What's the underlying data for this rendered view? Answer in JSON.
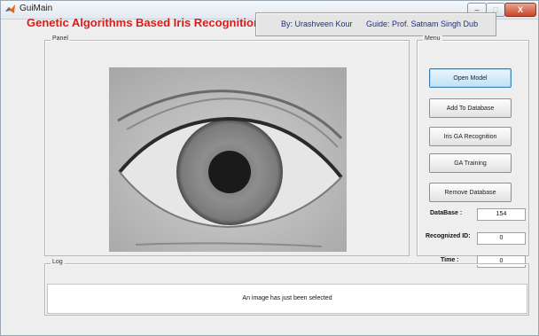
{
  "window": {
    "title": "GuiMain",
    "buttons": {
      "minimize": "–",
      "maximize": "□",
      "close": "X"
    }
  },
  "header": {
    "title": "Genetic Algorithms Based Iris Recognition",
    "author": "By: Urashveen Kour",
    "guide": "Guide: Prof. Satnam Singh Dub"
  },
  "panel": {
    "label": "Panel"
  },
  "menu": {
    "label": "Menu",
    "buttons": {
      "open_model": "Open Model",
      "add_db": "Add To Database",
      "iris_ga": "Iris GA Recognition",
      "ga_training": "GA Training",
      "remove_db": "Remove Database"
    },
    "fields": {
      "database_label": "DataBase :",
      "database_value": "154",
      "recognized_label": "Recognized ID:",
      "recognized_value": "0",
      "time_label": "Time :",
      "time_value": "0"
    }
  },
  "log": {
    "label": "Log",
    "message": "An image has just been selected"
  },
  "colors": {
    "title_red": "#e01a1a",
    "author_blue": "#1a2f8a",
    "focus_blue": "#3c7fb1"
  },
  "icons": {
    "app": "matlab-logo-icon",
    "image": "iris-eye-image"
  }
}
